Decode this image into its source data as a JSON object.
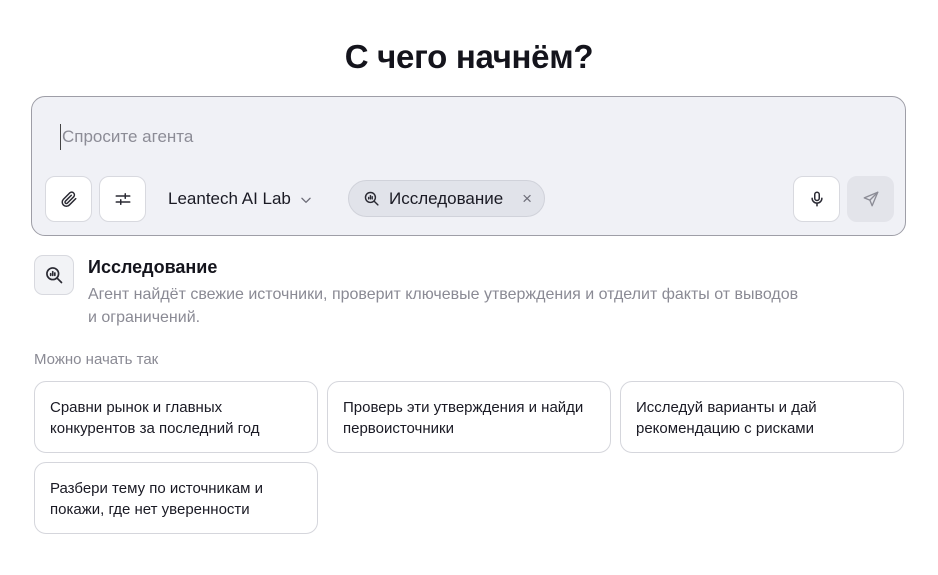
{
  "heading": "С чего начнём?",
  "composer": {
    "placeholder": "Спросите агента",
    "model": "Leantech AI Lab",
    "mode_chip": "Исследование",
    "chip_close": "×"
  },
  "mode_info": {
    "title": "Исследование",
    "description": "Агент найдёт свежие источники, проверит ключевые утверждения и отделит факты от выводов и ограничений."
  },
  "suggestions": {
    "label": "Можно начать так",
    "items": [
      "Сравни рынок и главных конкурентов за последний год",
      "Проверь эти утверждения и найди первоисточники",
      "Исследуй варианты и дай рекомендацию с рисками",
      "Разбери тему по источникам и покажи, где нет уверенности"
    ]
  },
  "icons": {
    "attach": "paperclip-icon",
    "settings": "sliders-icon",
    "model_dropdown": "chevron-down-icon",
    "mode": "search-chart-icon",
    "mic": "microphone-icon",
    "send": "send-icon"
  }
}
